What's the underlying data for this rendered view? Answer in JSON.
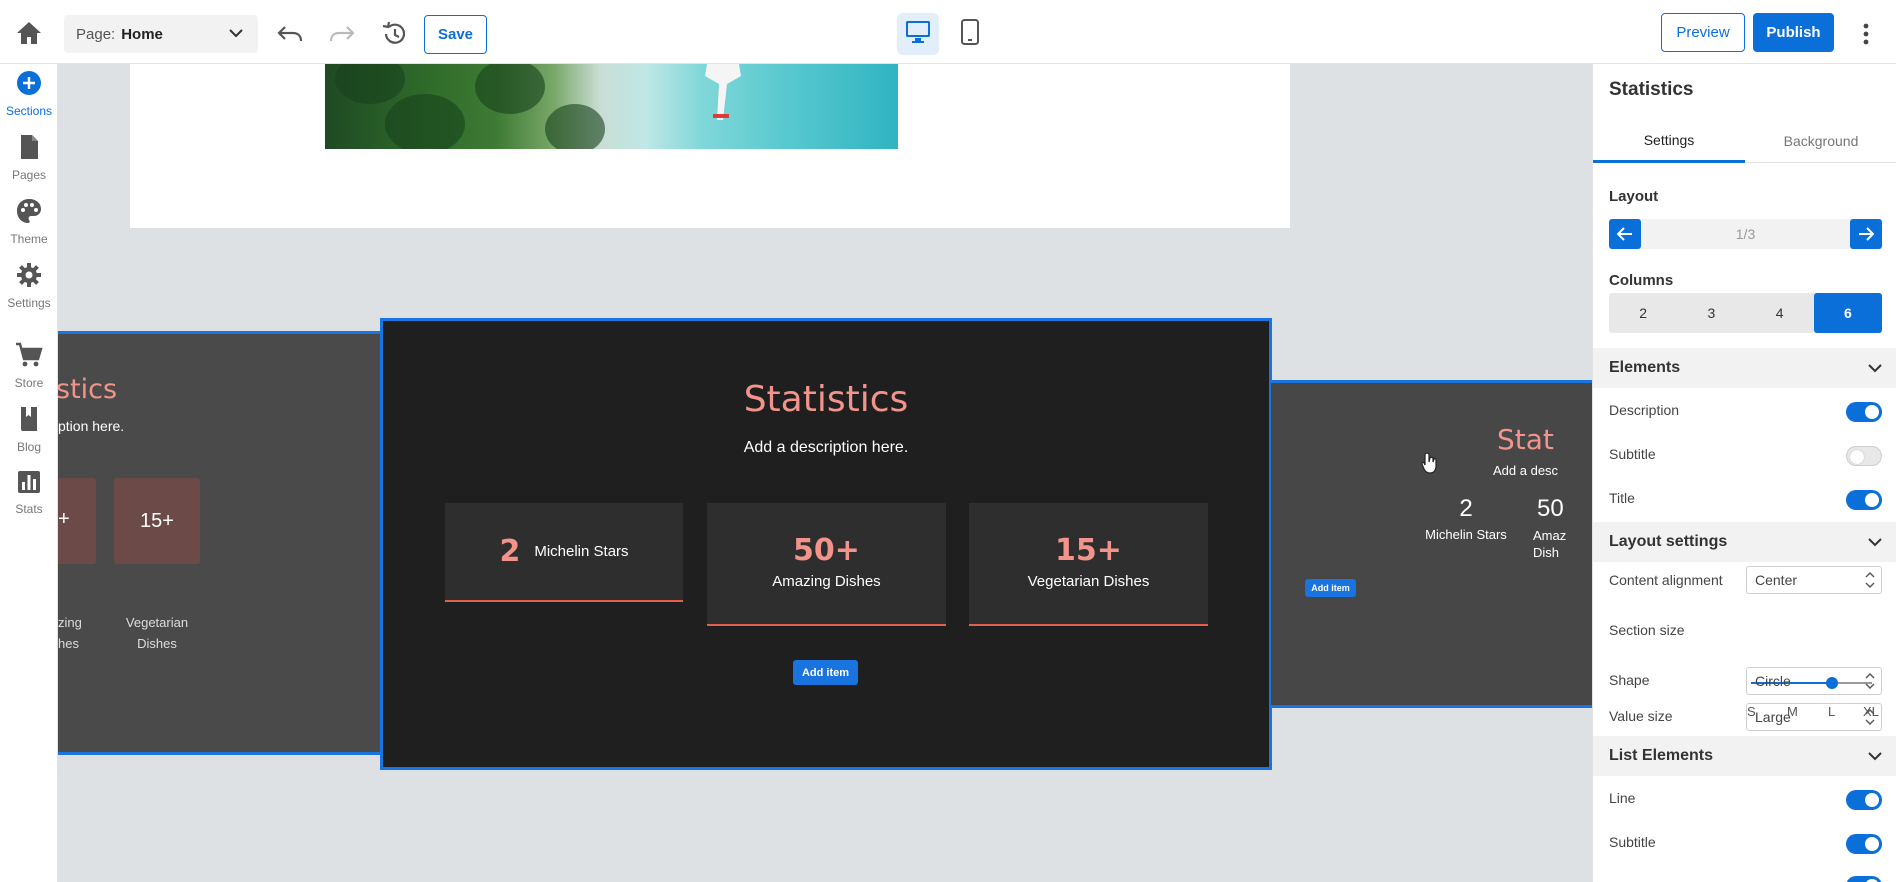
{
  "topbar": {
    "page_prefix": "Page:",
    "page_value": "Home",
    "save_label": "Save",
    "preview_label": "Preview",
    "publish_label": "Publish"
  },
  "sidebar": {
    "items": [
      {
        "label": "Sections",
        "icon": "plus-circle-icon"
      },
      {
        "label": "Pages",
        "icon": "page-icon"
      },
      {
        "label": "Theme",
        "icon": "palette-icon"
      },
      {
        "label": "Settings",
        "icon": "gear-icon"
      },
      {
        "label": "Store",
        "icon": "cart-icon"
      },
      {
        "label": "Blog",
        "icon": "book-icon"
      },
      {
        "label": "Stats",
        "icon": "bar-chart-icon"
      }
    ]
  },
  "canvas": {
    "left_section": {
      "title": "stics",
      "desc": "ption here.",
      "card1_value": "+",
      "card2_value": "15+",
      "label1_line1": "zing",
      "label1_line2": "hes",
      "label2_line1": "Vegetarian",
      "label2_line2": "Dishes"
    },
    "main_section": {
      "title": "Statistics",
      "desc": "Add a description here.",
      "items": [
        {
          "value": "2",
          "label": "Michelin Stars"
        },
        {
          "value": "50+",
          "label": "Amazing Dishes"
        },
        {
          "value": "15+",
          "label": "Vegetarian Dishes"
        }
      ],
      "add_item": "Add item"
    },
    "right_section": {
      "title": "Stat",
      "desc": "Add a desc",
      "item1_value": "2",
      "item1_label": "Michelin Stars",
      "item2_value": "50",
      "item2_line1": "Amaz",
      "item2_line2": "Dish",
      "add_item": "Add item"
    }
  },
  "panel": {
    "title": "Statistics",
    "tabs": [
      "Settings",
      "Background"
    ],
    "layout_label": "Layout",
    "layout_page": "1/3",
    "columns_label": "Columns",
    "columns": [
      "2",
      "3",
      "4",
      "6"
    ],
    "elements_header": "Elements",
    "elements": [
      {
        "label": "Description",
        "on": true
      },
      {
        "label": "Subtitle",
        "on": false
      },
      {
        "label": "Title",
        "on": true
      }
    ],
    "layout_settings_header": "Layout settings",
    "content_alignment_label": "Content alignment",
    "content_alignment_value": "Center",
    "section_size_label": "Section size",
    "section_size_options": [
      "S",
      "M",
      "L",
      "XL"
    ],
    "section_size_selected": "L",
    "shape_label": "Shape",
    "shape_value": "Circle",
    "value_size_label": "Value size",
    "value_size_value": "Large",
    "list_elements_header": "List Elements",
    "list_elements": [
      {
        "label": "Line",
        "on": true
      },
      {
        "label": "Subtitle",
        "on": true
      }
    ]
  }
}
